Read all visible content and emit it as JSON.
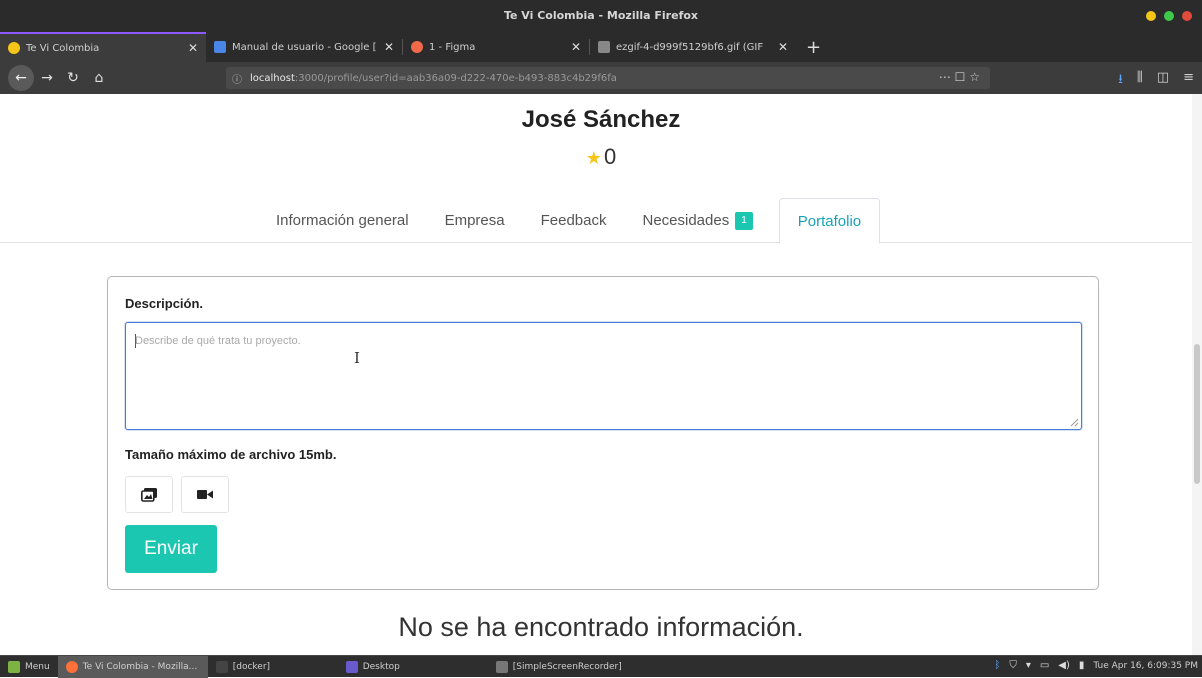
{
  "window": {
    "title": "Te Vi Colombia - Mozilla Firefox",
    "colors": {
      "min": "#f5c518",
      "max": "#3ec94b",
      "close": "#e24b3b"
    }
  },
  "browser_tabs": [
    {
      "label": "Te Vi Colombia",
      "favicon_color": "#f5c518",
      "active": true
    },
    {
      "label": "Manual de usuario - Google [",
      "favicon_color": "#4a86e8",
      "active": false
    },
    {
      "label": "1 - Figma",
      "favicon_color": "#f06a4a",
      "active": false
    },
    {
      "label": "ezgif-4-d999f5129bf6.gif (GIF",
      "favicon_color": "#888888",
      "active": false
    }
  ],
  "nav": {
    "url_host": "localhost",
    "url_path": ":3000/profile/user?id=aab36a09-d222-470e-b493-883c4b29f6fa",
    "page_actions": "⋯ ☐ ☆"
  },
  "profile": {
    "name": "José Sánchez",
    "rating": "0"
  },
  "tabs": [
    {
      "label": "Información general",
      "active": false
    },
    {
      "label": "Empresa",
      "active": false
    },
    {
      "label": "Feedback",
      "active": false
    },
    {
      "label": "Necesidades",
      "badge": "1",
      "active": false
    },
    {
      "label": "Portafolio",
      "active": true
    }
  ],
  "form": {
    "description_label": "Descripción.",
    "description_placeholder": "Describe de qué trata tu proyecto.",
    "max_size_label": "Tamaño máximo de archivo 15mb.",
    "submit_label": "Enviar"
  },
  "empty_message": "No se ha encontrado información.",
  "taskbar": {
    "menu_label": "Menu",
    "items": [
      {
        "label": "Te Vi Colombia - Mozilla...",
        "active": true
      },
      {
        "label": "[docker]",
        "active": false
      },
      {
        "label": "Desktop",
        "active": false
      },
      {
        "label": "[SimpleScreenRecorder]",
        "active": false
      }
    ],
    "clock": "Tue Apr 16, 6:09:35 PM"
  },
  "colors": {
    "accent": "#1cc7b1",
    "tab_active": "#17a2b8",
    "focus_border": "#4b7fd0",
    "star": "#f5c518"
  }
}
